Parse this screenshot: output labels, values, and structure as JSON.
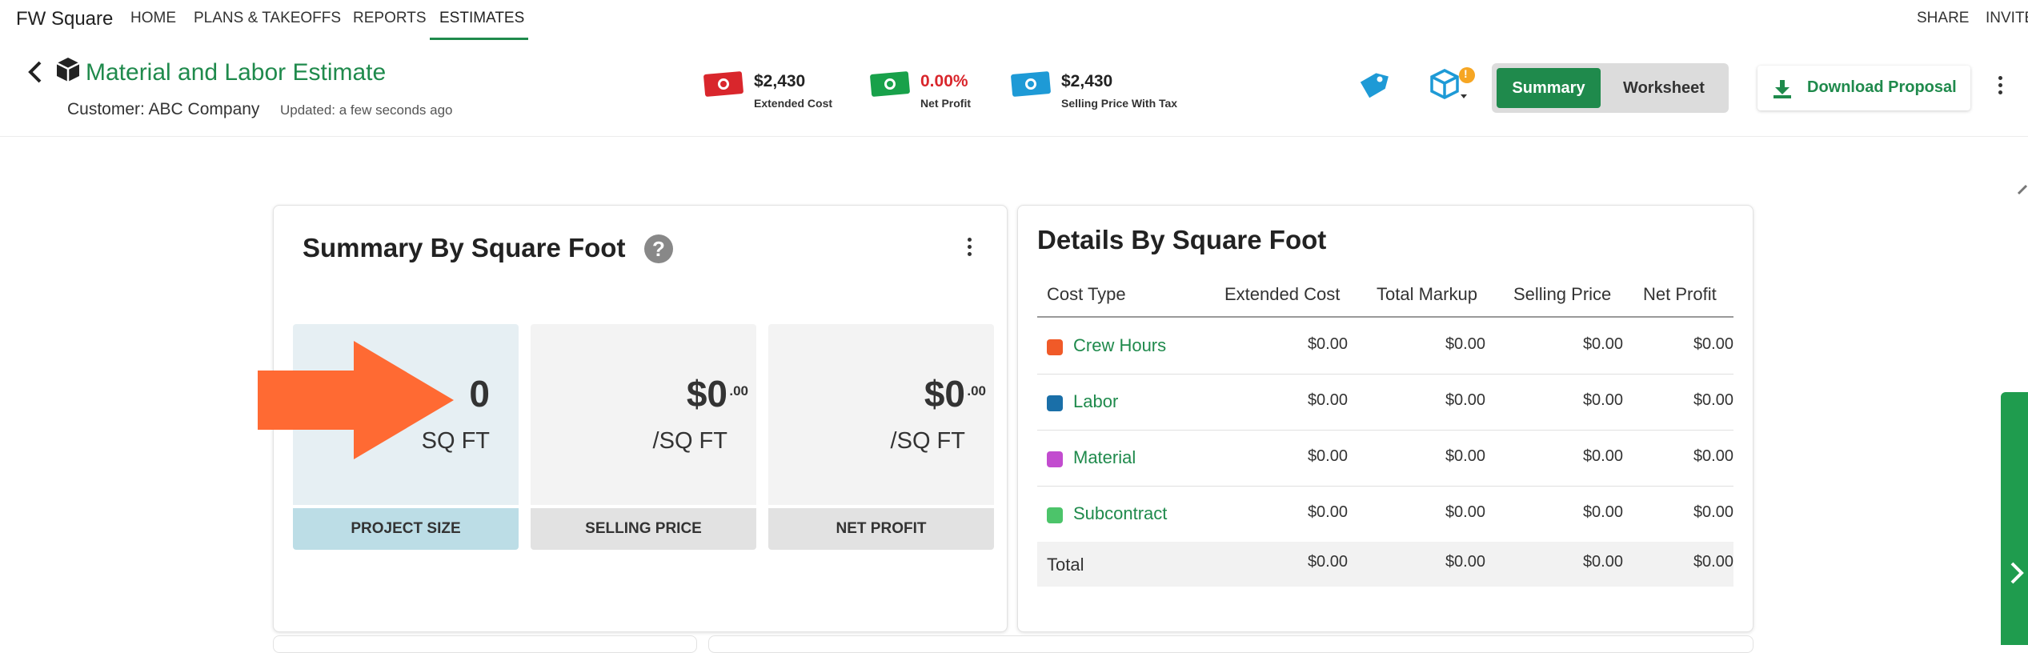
{
  "topnav": {
    "brand": "FW Square",
    "items": [
      "HOME",
      "PLANS & TAKEOFFS",
      "REPORTS",
      "ESTIMATES"
    ],
    "right_items": [
      "SHARE",
      "INVITE"
    ]
  },
  "header": {
    "title": "Material and Labor Estimate",
    "customer": "Customer: ABC Company",
    "updated": "Updated: a few seconds ago",
    "metrics": [
      {
        "value": "$2,430",
        "label": "Extended Cost",
        "color": "#d9262c"
      },
      {
        "value": "0.00%",
        "label": "Net Profit",
        "color": "#18a14a"
      },
      {
        "value": "$2,430",
        "label": "Selling Price With Tax",
        "color": "#1e9ad6"
      }
    ],
    "net_profit_value_color": "#d9262c",
    "badge": "!",
    "toggle": {
      "summary": "Summary",
      "worksheet": "Worksheet"
    },
    "download_label": "Download Proposal"
  },
  "summary_card": {
    "title": "Summary By Square Foot",
    "help": "?",
    "tiles": [
      {
        "value": "0",
        "cents": "",
        "unit": "SQ FT",
        "label": "PROJECT SIZE"
      },
      {
        "value": "$0",
        "cents": ".00",
        "unit": "/SQ FT",
        "label": "SELLING PRICE"
      },
      {
        "value": "$0",
        "cents": ".00",
        "unit": "/SQ FT",
        "label": "NET PROFIT"
      }
    ]
  },
  "details_card": {
    "title": "Details By Square Foot",
    "columns": [
      "Cost Type",
      "Extended Cost",
      "Total Markup",
      "Selling Price",
      "Net Profit"
    ],
    "rows": [
      {
        "label": "Crew Hours",
        "color": "#f05a28",
        "values": [
          "$0.00",
          "$0.00",
          "$0.00",
          "$0.00"
        ]
      },
      {
        "label": "Labor",
        "color": "#1a6fa8",
        "values": [
          "$0.00",
          "$0.00",
          "$0.00",
          "$0.00"
        ]
      },
      {
        "label": "Material",
        "color": "#c24ccf",
        "values": [
          "$0.00",
          "$0.00",
          "$0.00",
          "$0.00"
        ]
      },
      {
        "label": "Subcontract",
        "color": "#4cc46a",
        "values": [
          "$0.00",
          "$0.00",
          "$0.00",
          "$0.00"
        ]
      }
    ],
    "total": {
      "label": "Total",
      "values": [
        "$0.00",
        "$0.00",
        "$0.00",
        "$0.00"
      ]
    }
  },
  "colors": {
    "accent": "#1f8a4c",
    "arrow": "#ff6a33",
    "project_tile": "#e6eff3",
    "project_tile_label": "#bcdde6"
  }
}
